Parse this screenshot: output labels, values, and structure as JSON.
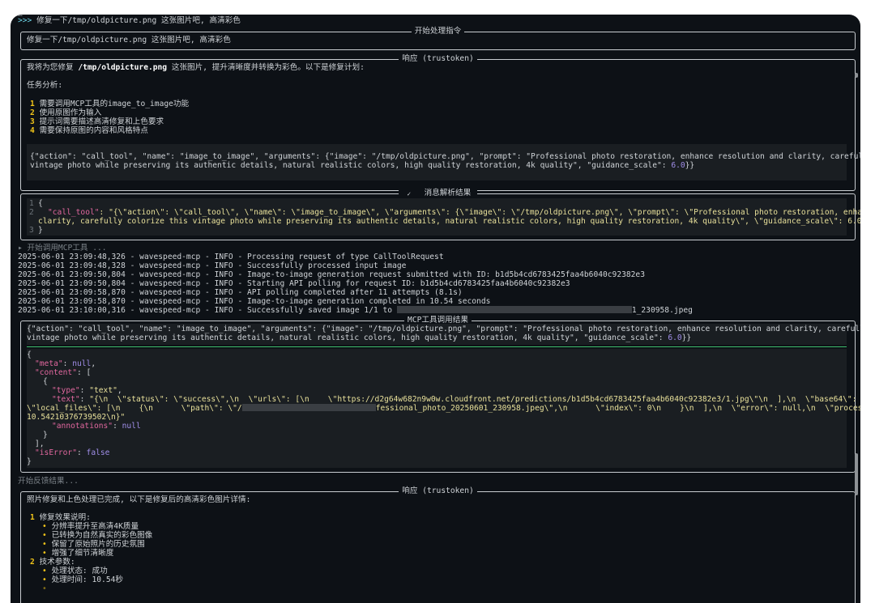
{
  "header": {
    "prompt_symbol": ">>>",
    "user_command": "修复一下/tmp/oldpicture.png 这张图片吧, 高清彩色"
  },
  "start_box": {
    "title": "开始处理指令",
    "text": "修复一下/tmp/oldpicture.png 这张图片吧, 高清彩色"
  },
  "response1": {
    "title": "响应 (trustoken)",
    "intro_pre": "我将为您修复 ",
    "intro_file": "/tmp/oldpicture.png",
    "intro_post": " 这张图片, 提升清晰度并转换为彩色。以下是修复计划:",
    "analysis_heading": "任务分析:",
    "items": [
      {
        "num": "1",
        "text": "需要调用MCP工具的image_to_image功能"
      },
      {
        "num": "2",
        "text": "使用原图作为输入"
      },
      {
        "num": "3",
        "text": "提示词需要描述高清修复和上色要求"
      },
      {
        "num": "4",
        "text": "需要保持原图的内容和风格特点"
      }
    ],
    "code_line1_a": "{\"action\": \"call_tool\", \"name\": \"image_to_image\", \"arguments\": {\"image\": \"/tmp/oldpicture.png\", \"prompt\": \"Professional photo restoration, enhance resolution and clarity, carefully colorize this",
    "code_line2_a": "vintage photo while preserving its authentic details, natural realistic colors, high quality restoration, 4k quality\", \"guidance_scale\": ",
    "code_line2_num": "6.0",
    "code_line2_end": "}}"
  },
  "parse_box": {
    "title": "消息解析结果",
    "gutter": [
      "1",
      "2",
      "",
      "3"
    ],
    "line1": "{",
    "line2_key": "\"call_tool\"",
    "line2_rest": ": \"{\\\"action\\\": \\\"call_tool\\\", \\\"name\\\": \\\"image_to_image\\\", \\\"arguments\\\": {\\\"image\\\": \\\"/tmp/oldpicture.png\\\", \\\"prompt\\\": \\\"Professional photo restoration, enhance resolution and",
    "line2b": "clarity, carefully colorize this vintage photo while preserving its authentic details, natural realistic colors, high quality restoration, 4k quality\\\", \\\"guidance_scale\\\": 6.0}}\"",
    "line3": "}"
  },
  "status_calling": "▸ 开始调用MCP工具 ...",
  "logs": [
    "2025-06-01 23:09:48,326 - wavespeed-mcp - INFO - Processing request of type CallToolRequest",
    "2025-06-01 23:09:48,328 - wavespeed-mcp - INFO - Successfully processed input image",
    "2025-06-01 23:09:50,804 - wavespeed-mcp - INFO - Image-to-image generation request submitted with ID: b1d5b4cd6783425faa4b6040c92382e3",
    "2025-06-01 23:09:50,804 - wavespeed-mcp - INFO - Starting API polling for request ID: b1d5b4cd6783425faa4b6040c92382e3",
    "2025-06-01 23:09:58,870 - wavespeed-mcp - INFO - API polling completed after 11 attempts (8.1s)",
    "2025-06-01 23:09:58,870 - wavespeed-mcp - INFO - Image-to-image generation completed in 10.54 seconds"
  ],
  "log_last_pre": "2025-06-01 23:10:00,316 - wavespeed-mcp - INFO - Successfully saved image 1/1 to ",
  "log_last_post": "1_230958.jpeg",
  "mcp_box": {
    "title": "MCP工具调用结果",
    "req_line1": "{\"action\": \"call_tool\", \"name\": \"image_to_image\", \"arguments\": {\"image\": \"/tmp/oldpicture.png\", \"prompt\": \"Professional photo restoration, enhance resolution and clarity, carefully colorize this",
    "req_line2": "vintage photo while preserving its authentic details, natural realistic colors, high quality restoration, 4k quality\", \"guidance_scale\": ",
    "req_num": "6.0",
    "req_end": "}}",
    "open": "{",
    "meta_key": "\"meta\"",
    "meta_val": "null",
    "content_key": "\"content\"",
    "content_open": ": [",
    "obj_open": "{",
    "type_key": "\"type\"",
    "type_val": "\"text\"",
    "text_key": "\"text\"",
    "text_val1": "\"{\\n  \\\"status\\\": \\\"success\\\",\\n  \\\"urls\\\": [\\n    \\\"https://d2g64w682n9w0w.cloudfront.net/predictions/b1d5b4cd6783425faa4b6040c92382e3/1.jpg\\\"\\n  ],\\n  \\\"base64\\\": [],\\n",
    "text_val2_a": "\\\"local_files\\\": [\\n    {\\n      \\\"path\\\": \\\"/",
    "text_val2_b": "fessional_photo_20250601_230958.jpeg\\\",\\n      \\\"index\\\": 0\\n    }\\n  ],\\n  \\\"error\\\": null,\\n  \\\"processing_time\\\":",
    "text_val3": "10.54210376739502\\n}\"",
    "ann_key": "\"annotations\"",
    "ann_val": "null",
    "obj_close": "}",
    "arr_close": "],",
    "err_key": "\"isError\"",
    "err_val": "false",
    "close": "}"
  },
  "status_feedback": "开始反馈结果...",
  "response2": {
    "title": "响应 (trustoken)",
    "intro": "照片修复和上色处理已完成, 以下是修复后的高清彩色图片详情:",
    "sec1_num": "1",
    "sec1_title": "修复效果说明:",
    "sec1_items": [
      "分辨率提升至高清4K质量",
      "已转换为自然真实的彩色图像",
      "保留了原始照片的历史氛围",
      "增强了细节清晰度"
    ],
    "sec2_num": "2",
    "sec2_title": "技术参数:",
    "sec2_items": [
      "处理状态: 成功",
      "处理时间: 10.54秒"
    ]
  },
  "colors": {
    "background": "#0d1116",
    "code_bg": "#1a1e22",
    "key": "#e0679e",
    "string": "#e8e09a",
    "number": "#a08ee8",
    "list_num": "#f0c419"
  }
}
